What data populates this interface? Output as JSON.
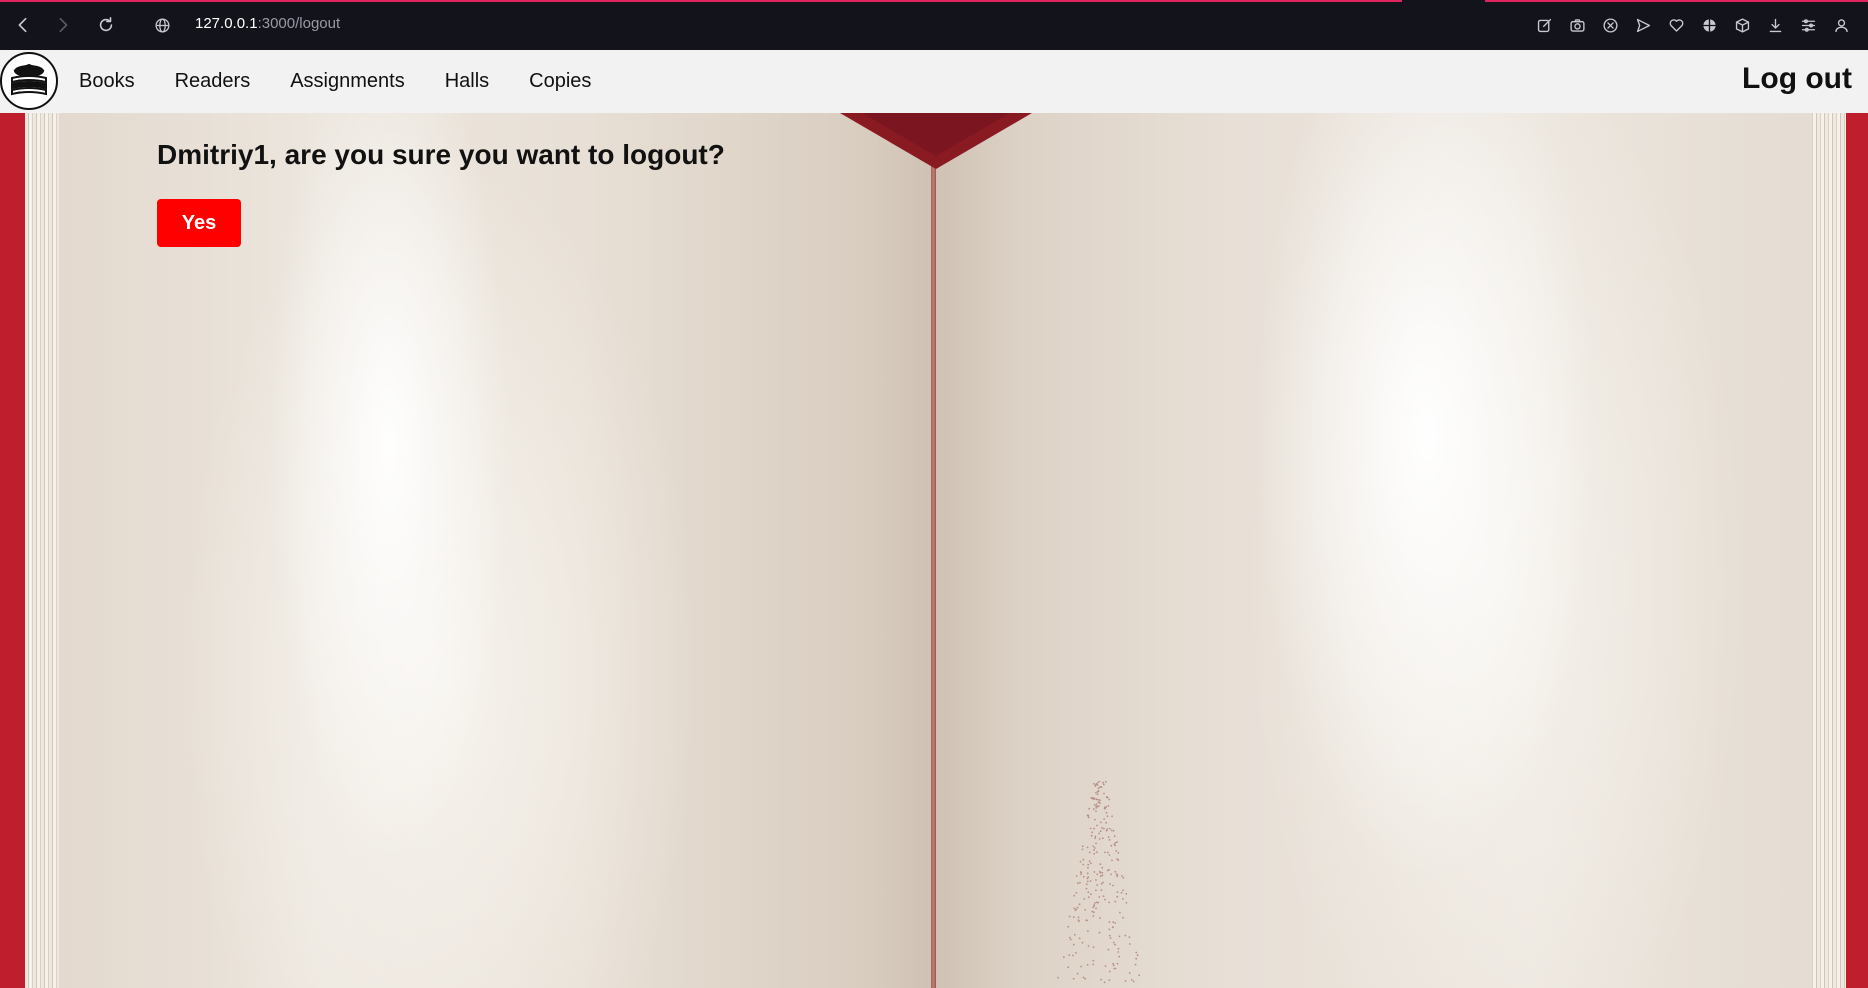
{
  "browser": {
    "url_host": "127.0.0.1",
    "url_path": ":3000/logout",
    "icons": [
      "back-icon",
      "forward-icon",
      "reload-icon",
      "site-info-icon",
      "edit-icon",
      "camera-icon",
      "shield-icon",
      "send-icon",
      "heart-icon",
      "vpn-icon",
      "box-icon",
      "download-icon",
      "settings-icon",
      "profile-icon"
    ]
  },
  "nav": {
    "logo_icon": "books-stack-icon",
    "links": [
      {
        "label": "Books"
      },
      {
        "label": "Readers"
      },
      {
        "label": "Assignments"
      },
      {
        "label": "Halls"
      },
      {
        "label": "Copies"
      }
    ],
    "logout_label": "Log out"
  },
  "main": {
    "prompt": "Dmitriy1, are you sure you want to logout?",
    "confirm_label": "Yes"
  },
  "colors": {
    "confirm_button": "#ff0000",
    "cover": "#bf1f2c",
    "ribbon": "#8a1a22",
    "nav_bg": "#f2f2f2"
  }
}
